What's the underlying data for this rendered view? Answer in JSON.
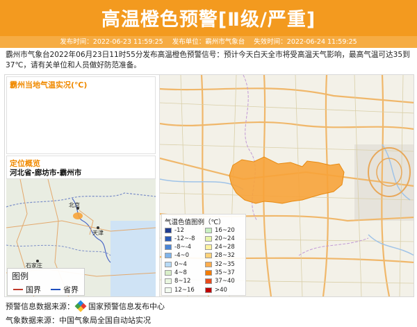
{
  "header": {
    "title": "高温橙色预警[Ⅱ级/严重]",
    "meta": [
      "发布时间：2022-06-23 11:59:25",
      "发布单位：霸州市气象台",
      "失效时间：2022-06-24 11:59:25"
    ]
  },
  "description": "霸州市气象台2022年06月23日11时55分发布高温橙色预警信号：预计今天白天全市将受高温天气影响，最高气温可达35到37℃，请有关单位和人员做好防范准备。",
  "temp_panel": {
    "title": "霸州当地气温实况(℃)"
  },
  "location_panel": {
    "title": "定位概览",
    "place": "河北省-廊坊市-霸州市"
  },
  "mini_map": {
    "labels": [
      "北京",
      "天津",
      "石家庄"
    ],
    "legend_title": "图例",
    "legend_items": [
      {
        "label": "国界",
        "color": "#c0392b"
      },
      {
        "label": "省界",
        "color": "#1f4fbf"
      }
    ]
  },
  "temp_legend": {
    "title": "气温色值图例（℃）",
    "items": [
      {
        "label": "-12",
        "color": "#1f3c8f"
      },
      {
        "label": "16~20",
        "color": "#c8efc0"
      },
      {
        "label": "-12~-8",
        "color": "#2a5bb8"
      },
      {
        "label": "20~24",
        "color": "#e8f5a8"
      },
      {
        "label": "-8~-4",
        "color": "#4a86d6"
      },
      {
        "label": "24~28",
        "color": "#fff3a0"
      },
      {
        "label": "-4~0",
        "color": "#7fb4ea"
      },
      {
        "label": "28~32",
        "color": "#ffd37a"
      },
      {
        "label": "0~4",
        "color": "#b7daf5"
      },
      {
        "label": "32~35",
        "color": "#ffad4d"
      },
      {
        "label": "4~8",
        "color": "#d9efc9"
      },
      {
        "label": "35~37",
        "color": "#f57c00"
      },
      {
        "label": "8~12",
        "color": "#eaf7e0"
      },
      {
        "label": "37~40",
        "color": "#e84a1b"
      },
      {
        "label": "12~16",
        "color": "#f2fbef"
      },
      {
        "label": ">40",
        "color": "#c00000"
      }
    ]
  },
  "footer": {
    "source1_label": "预警信息数据来源：",
    "source1_value": "国家预警信息发布中心",
    "source2": "气象数据来源：中国气象局全国自动站实况"
  },
  "colors": {
    "banner": "#f39a1f",
    "meta_bar": "#f6ac43",
    "warning_area": "#f7a33a"
  }
}
